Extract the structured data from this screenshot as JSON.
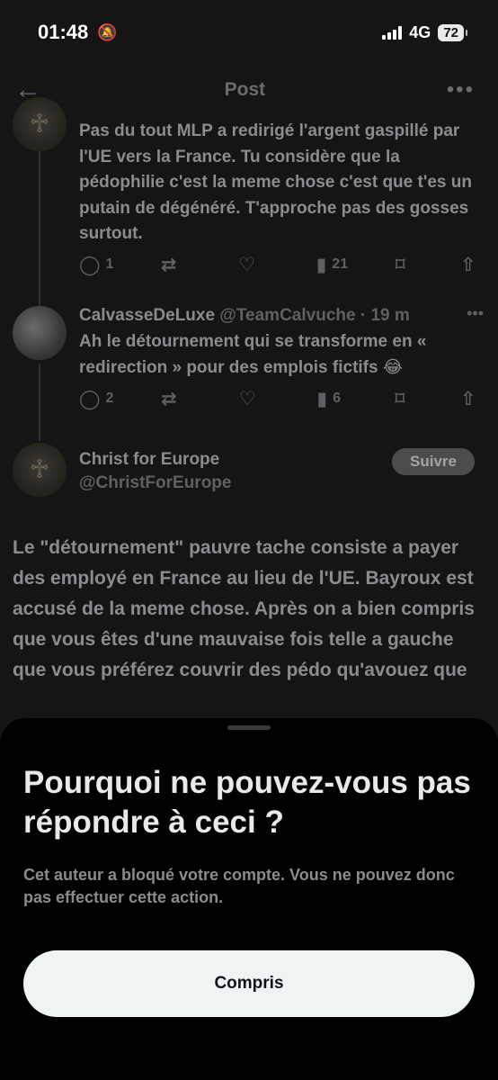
{
  "status_bar": {
    "time": "01:48",
    "network": "4G",
    "battery": "72"
  },
  "header": {
    "title": "Post"
  },
  "tweets": [
    {
      "text": "Pas du tout MLP a redirigé l'argent gaspillé par l'UE vers la France. Tu considère que la pédophilie c'est la meme chose c'est que t'es un putain de dégénéré. T'approche pas des gosses surtout.",
      "replies": "1",
      "retweets": "",
      "likes": "",
      "views": "21"
    },
    {
      "name": "CalvasseDeLuxe",
      "handle": "@TeamCalvuche · 19 m",
      "text": "Ah le détournement qui se transforme en « redirection » pour des emplois fictifs 😂",
      "replies": "2",
      "retweets": "",
      "likes": "",
      "views": "6"
    }
  ],
  "main_post": {
    "name": "Christ for Europe",
    "handle": "@ChristForEurope",
    "follow_label": "Suivre",
    "text": "Le \"détournement\" pauvre tache consiste a payer des employé en France au lieu de l'UE. Bayroux est accusé de la meme chose. Après on a bien compris que vous êtes d'une mauvaise fois telle a gauche que vous préférez couvrir des pédo qu'avouez que"
  },
  "sheet": {
    "title": "Pourquoi ne pouvez-vous pas répondre à ceci ?",
    "body": "Cet auteur a bloqué votre compte. Vous ne pouvez donc pas effectuer cette action.",
    "button_label": "Compris"
  },
  "icons": {
    "back": "arrow-left-icon",
    "more": "more-icon",
    "reply": "reply-icon",
    "retweet": "retweet-icon",
    "like": "heart-icon",
    "views": "views-icon",
    "bookmark": "bookmark-icon",
    "share": "share-icon"
  }
}
